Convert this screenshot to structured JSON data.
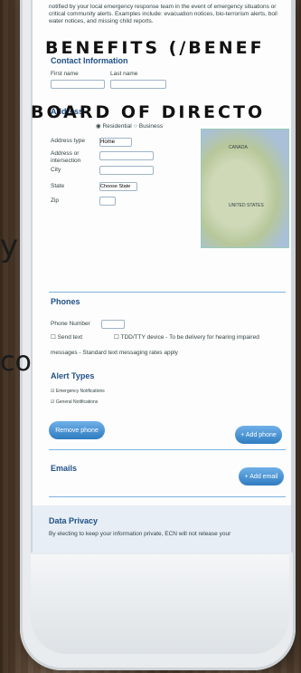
{
  "overlay": {
    "benefits_link": "BENEFITS (/BENEF",
    "board_link": "BOARD OF DIRECTO",
    "side_glyph_1": "y",
    "side_glyph_2": "co"
  },
  "form": {
    "intro_text": "notified by your local emergency response team in the event of emergency situations or critical community alerts. Examples include: evacuation notices, bio-terrorism alerts, boil water notices, and missing child reports.",
    "contact_title": "Contact Information",
    "first_name_label": "First name",
    "last_name_label": "Last name",
    "address_title": "Address",
    "address_type_label": "Address type",
    "address_type_value": "Home",
    "residential_option": "Residential",
    "business_option": "Business",
    "address_fields": [
      "Address or intersection",
      "City",
      "State",
      "Zip"
    ],
    "state_value": "Choose State",
    "phones_title": "Phones",
    "phone_label": "Phone Number",
    "send_text_label": "Send text",
    "tdd_text": "TDD/TTY device - To be delivery for hearing impaired",
    "std_text": "messages - Standard text messaging rates apply",
    "alert_title": "Alert Types",
    "alert_options": [
      "Emergency Notifications",
      "General Notifications"
    ],
    "remove_phone_btn": "Remove phone",
    "add_phone_btn": "+ Add phone",
    "emails_title": "Emails",
    "add_email_btn": "+ Add email",
    "privacy_title": "Data Privacy",
    "privacy_text": "By electing to keep your information private, ECN will not release your"
  },
  "map": {
    "labels": [
      "CANADA",
      "UNITED STATES"
    ]
  }
}
